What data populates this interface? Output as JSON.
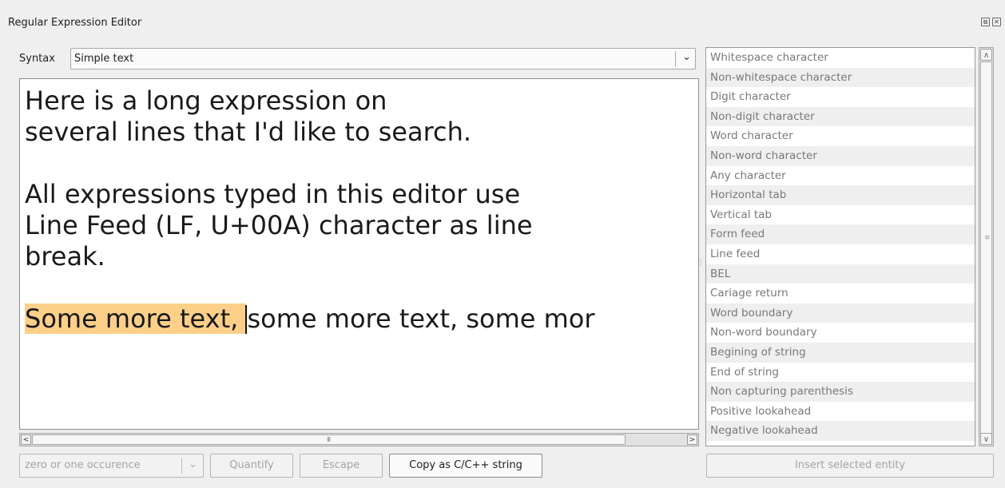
{
  "window": {
    "title": "Regular Expression Editor",
    "float_icon": "⧉",
    "close_icon": "✕"
  },
  "syntax": {
    "label": "Syntax",
    "value": "Simple text",
    "arrow": "⌄"
  },
  "editor": {
    "line1": "Here is a long expression on",
    "line2": "several lines that I'd like to search.",
    "line3": "",
    "line4": "All expressions typed in this editor use",
    "line5": "Line Feed (LF, U+00A) character as line",
    "line6": "break.",
    "line7": "",
    "line8_selected": "Some more text, ",
    "line8_rest": "some more text, some mor",
    "selection_color": "#fdd089"
  },
  "hscroll": {
    "left": "<",
    "right": ">",
    "grip": "III"
  },
  "entities": [
    "Whitespace character",
    "Non-whitespace character",
    "Digit character",
    "Non-digit character",
    "Word character",
    "Non-word character",
    "Any character",
    "Horizontal tab",
    "Vertical tab",
    "Form feed",
    "Line feed",
    "BEL",
    "Cariage return",
    "Word boundary",
    "Non-word boundary",
    "Begining of string",
    "End of string",
    "Non capturing parenthesis",
    "Positive lookahead",
    "Negative lookahead"
  ],
  "vscroll": {
    "up": "^",
    "down": "v",
    "grip": "≡"
  },
  "bottom": {
    "quantifier_value": "zero or one occurence",
    "quantify_label": "Quantify",
    "escape_label": "Escape",
    "copy_label": "Copy as C/C++ string",
    "insert_label": "Insert selected entity"
  }
}
